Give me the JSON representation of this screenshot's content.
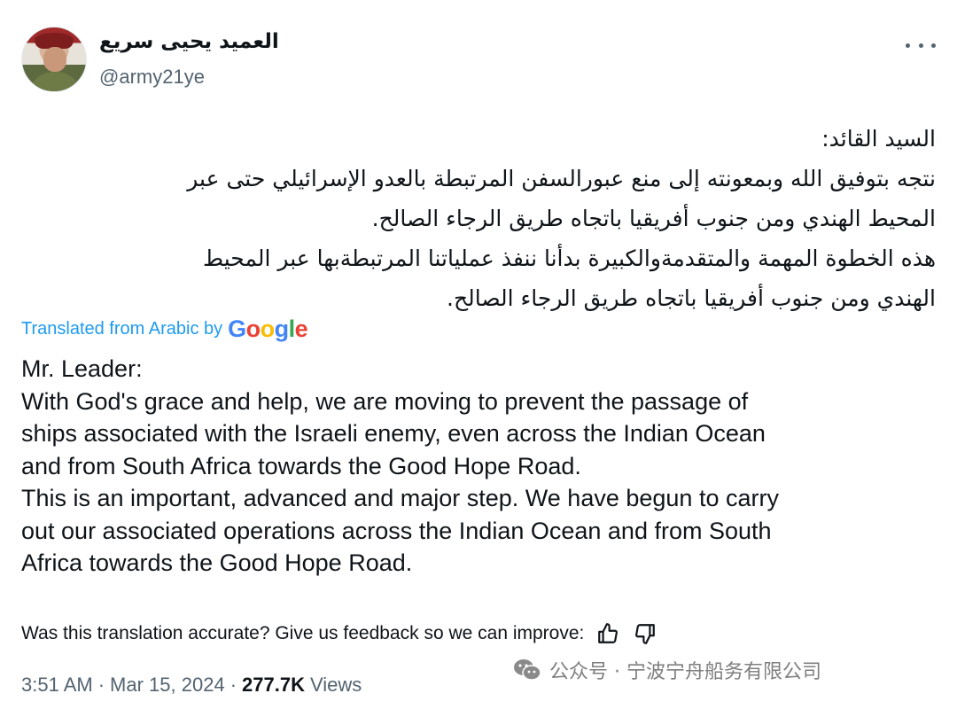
{
  "author": {
    "display_name": "العميد يحيى سريع",
    "handle": "@army21ye"
  },
  "tweet": {
    "arabic_lines": [
      "السيد القائد:",
      "نتجه بتوفيق الله وبمعونته إلى منع عبورالسفن المرتبطة بالعدو الإسرائيلي حتى عبر",
      "المحيط الهندي ومن جنوب أفريقيا باتجاه طريق الرجاء الصالح.",
      "هذه الخطوة المهمة والمتقدمةوالكبيرة بدأنا ننفذ عملياتنا المرتبطةبها عبر المحيط",
      "الهندي ومن جنوب أفريقيا باتجاه طريق الرجاء الصالح."
    ],
    "translated_label": "Translated from Arabic by",
    "translator_logo_text": "Google",
    "english_lines": [
      "Mr. Leader:",
      "With God's grace and help, we are moving to prevent the passage of",
      "ships associated with the Israeli enemy, even across the Indian Ocean",
      "and from South Africa towards the Good Hope Road.",
      "This is an important, advanced and major step. We have begun to carry",
      "out our associated operations across the Indian Ocean and from South",
      "Africa towards the Good Hope Road."
    ],
    "feedback_prompt": "Was this translation accurate? Give us feedback so we can improve:",
    "time": "3:51 AM",
    "separator": "·",
    "date": "Mar 15, 2024",
    "views_count": "277.7K",
    "views_label": "Views"
  },
  "watermark": {
    "text": "公众号 · 宁波宁舟船务有限公司"
  },
  "icons": [
    "more-icon",
    "thumbs-up-icon",
    "thumbs-down-icon",
    "wechat-icon"
  ],
  "colors": {
    "link_blue": "#1d9bf0",
    "secondary_text": "#536471",
    "primary_text": "#0f1419"
  }
}
